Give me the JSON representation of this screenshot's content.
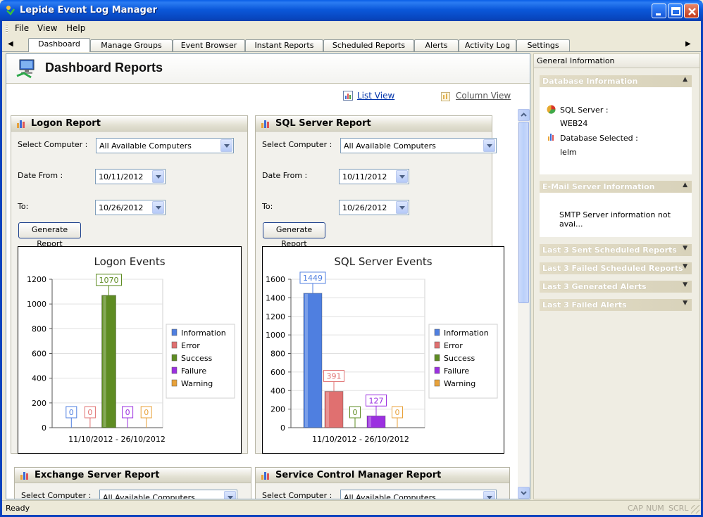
{
  "window": {
    "title": "Lepide Event Log Manager"
  },
  "menu": {
    "file": "File",
    "view": "View",
    "help": "Help"
  },
  "tabs": [
    "Dashboard",
    "Manage Groups",
    "Event Browser",
    "Instant Reports",
    "Scheduled Reports",
    "Alerts",
    "Activity Log",
    "Settings"
  ],
  "active_tab": "Dashboard",
  "page": {
    "title": "Dashboard Reports",
    "list_view": "List View",
    "column_view": "Column View"
  },
  "reports": {
    "logon": {
      "title": "Logon Report",
      "select_computer_label": "Select Computer :",
      "select_computer_value": "All Available Computers",
      "date_from_label": "Date From :",
      "date_from_value": "10/11/2012",
      "to_label": "To:",
      "to_value": "10/26/2012",
      "button": "Generate Report"
    },
    "sql": {
      "title": "SQL Server Report",
      "select_computer_label": "Select Computer :",
      "select_computer_value": "All Available Computers",
      "date_from_label": "Date From :",
      "date_from_value": "10/11/2012",
      "to_label": "To:",
      "to_value": "10/26/2012",
      "button": "Generate Report"
    },
    "exchange": {
      "title": "Exchange Server Report",
      "select_computer_label": "Select Computer :",
      "select_computer_value": "All Available Computers"
    },
    "scm": {
      "title": "Service Control Manager Report",
      "select_computer_label": "Select Computer :",
      "select_computer_value": "All Available Computers"
    }
  },
  "chart_data": [
    {
      "type": "bar",
      "title": "Logon Events",
      "xlabel": "11/10/2012 - 26/10/2012",
      "ylim": [
        0,
        1200
      ],
      "yticks": [
        0,
        200,
        400,
        600,
        800,
        1000,
        1200
      ],
      "legend_position": "right",
      "series": [
        {
          "name": "Information",
          "values": [
            0
          ],
          "color": "#4F7FE0"
        },
        {
          "name": "Error",
          "values": [
            0
          ],
          "color": "#E07070"
        },
        {
          "name": "Success",
          "values": [
            1070
          ],
          "color": "#5E8C22"
        },
        {
          "name": "Failure",
          "values": [
            0
          ],
          "color": "#9B30E0"
        },
        {
          "name": "Warning",
          "values": [
            0
          ],
          "color": "#E8A23A"
        }
      ]
    },
    {
      "type": "bar",
      "title": "SQL Server Events",
      "xlabel": "11/10/2012 - 26/10/2012",
      "ylim": [
        0,
        1600
      ],
      "yticks": [
        0,
        200,
        400,
        600,
        800,
        1000,
        1200,
        1400,
        1600
      ],
      "legend_position": "right",
      "series": [
        {
          "name": "Information",
          "values": [
            1449
          ],
          "color": "#4F7FE0"
        },
        {
          "name": "Error",
          "values": [
            391
          ],
          "color": "#E07070"
        },
        {
          "name": "Success",
          "values": [
            0
          ],
          "color": "#5E8C22"
        },
        {
          "name": "Failure",
          "values": [
            127
          ],
          "color": "#9B30E0"
        },
        {
          "name": "Warning",
          "values": [
            0
          ],
          "color": "#E8A23A"
        }
      ]
    }
  ],
  "right_panel": {
    "header": "General Information",
    "db_group": "Database Information",
    "sql_server_label": "SQL Server :",
    "sql_server_value": "WEB24",
    "db_selected_label": "Database Selected :",
    "db_selected_value": "lelm",
    "email_group": "E-Mail Server Information",
    "smtp_text": "SMTP Server information not avai...",
    "sent_group": "Last 3 Sent Scheduled Reports",
    "failed_sched_group": "Last 3 Failed Scheduled Reports",
    "gen_alerts_group": "Last 3 Generated Alerts",
    "failed_alerts_group": "Last 3 Failed Alerts"
  },
  "status": {
    "text": "Ready",
    "cap": "CAP",
    "num": "NUM",
    "scrl": "SCRL"
  }
}
